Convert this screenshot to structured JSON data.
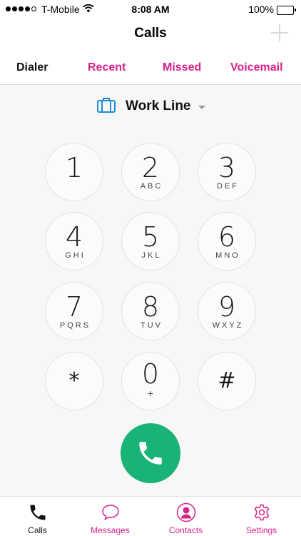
{
  "status_bar": {
    "carrier": "T-Mobile",
    "time": "8:08 AM",
    "battery": "100%"
  },
  "nav": {
    "title": "Calls"
  },
  "tabs": [
    {
      "label": "Dialer",
      "active": true
    },
    {
      "label": "Recent",
      "active": false
    },
    {
      "label": "Missed",
      "active": false
    },
    {
      "label": "Voicemail",
      "active": false
    }
  ],
  "line": {
    "label": "Work Line"
  },
  "keypad": [
    {
      "digit": "1",
      "letters": ""
    },
    {
      "digit": "2",
      "letters": "ABC"
    },
    {
      "digit": "3",
      "letters": "DEF"
    },
    {
      "digit": "4",
      "letters": "GHI"
    },
    {
      "digit": "5",
      "letters": "JKL"
    },
    {
      "digit": "6",
      "letters": "MNO"
    },
    {
      "digit": "7",
      "letters": "PQRS"
    },
    {
      "digit": "8",
      "letters": "TUV"
    },
    {
      "digit": "9",
      "letters": "WXYZ"
    },
    {
      "digit": "*",
      "letters": ""
    },
    {
      "digit": "0",
      "letters": "+"
    },
    {
      "digit": "#",
      "letters": ""
    }
  ],
  "tab_bar": [
    {
      "label": "Calls",
      "icon": "phone-icon",
      "active": true
    },
    {
      "label": "Messages",
      "icon": "speech-bubble-icon",
      "active": false
    },
    {
      "label": "Contacts",
      "icon": "person-icon",
      "active": false
    },
    {
      "label": "Settings",
      "icon": "gear-icon",
      "active": false
    }
  ],
  "colors": {
    "accent": "#d6228b",
    "call_green": "#19b378",
    "line_icon_blue": "#1d8ad6"
  }
}
